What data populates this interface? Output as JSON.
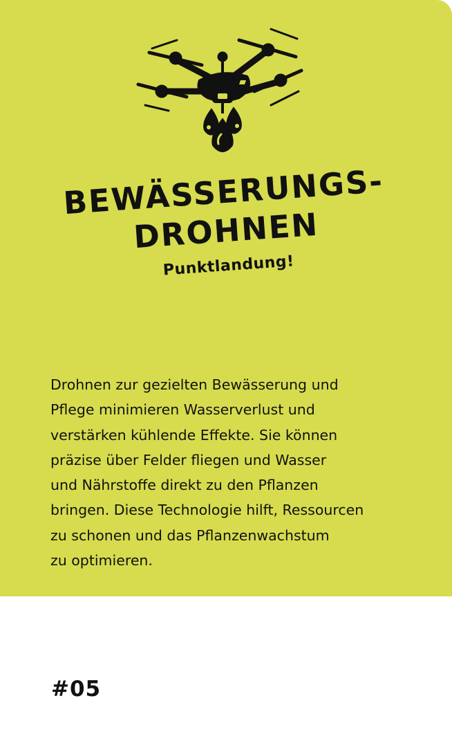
{
  "card": {
    "title_line1": "BEWÄSSERUNGS-",
    "title_line2": "DROHNEN",
    "subtitle": "Punktlandung!",
    "body": "Drohnen zur gezielten Bewässerung und\nPflege minimieren Wasserverlust und\nverstärken kühlende Effekte. Sie können\npräzise über Felder fliegen und Wasser\nund Nährstoffe direkt zu den Pflanzen\nbringen. Diese Technologie hilft, Ressourcen\nzu schonen und das Pflanzenwachstum\nzu optimieren.",
    "number": "#05",
    "icon": "drone-icon"
  },
  "colors": {
    "panel": "#d6dc4e",
    "ink": "#111111",
    "background": "#ffffff"
  }
}
